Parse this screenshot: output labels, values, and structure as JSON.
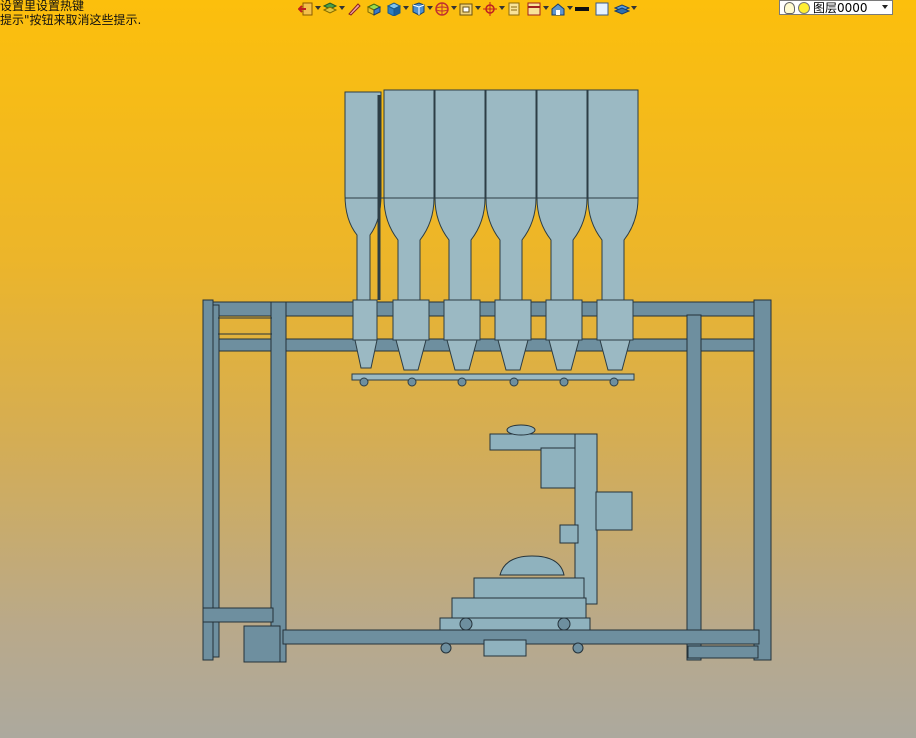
{
  "hints": {
    "line1": "设置里设置热键",
    "line2": "提示\"按钮来取消这些提示."
  },
  "toolbar": {
    "icons": [
      "exit-icon",
      "layer-manager-icon",
      "pen-icon",
      "hatch-icon",
      "cube-icon",
      "view-cube-icon",
      "sphere-icon",
      "coordinate-icon",
      "crosshair-icon",
      "document-icon",
      "window-icon",
      "house-icon",
      "line-style-icon",
      "color-swatch-icon",
      "layers-icon"
    ]
  },
  "layer": {
    "current": "图层0000"
  },
  "colors": {
    "frame": "#6e8f9f",
    "frame_dark": "#24323a",
    "bottle": "#9bb9c3",
    "bottle_dark": "#2c3d45",
    "motor": "#8fb2be"
  }
}
